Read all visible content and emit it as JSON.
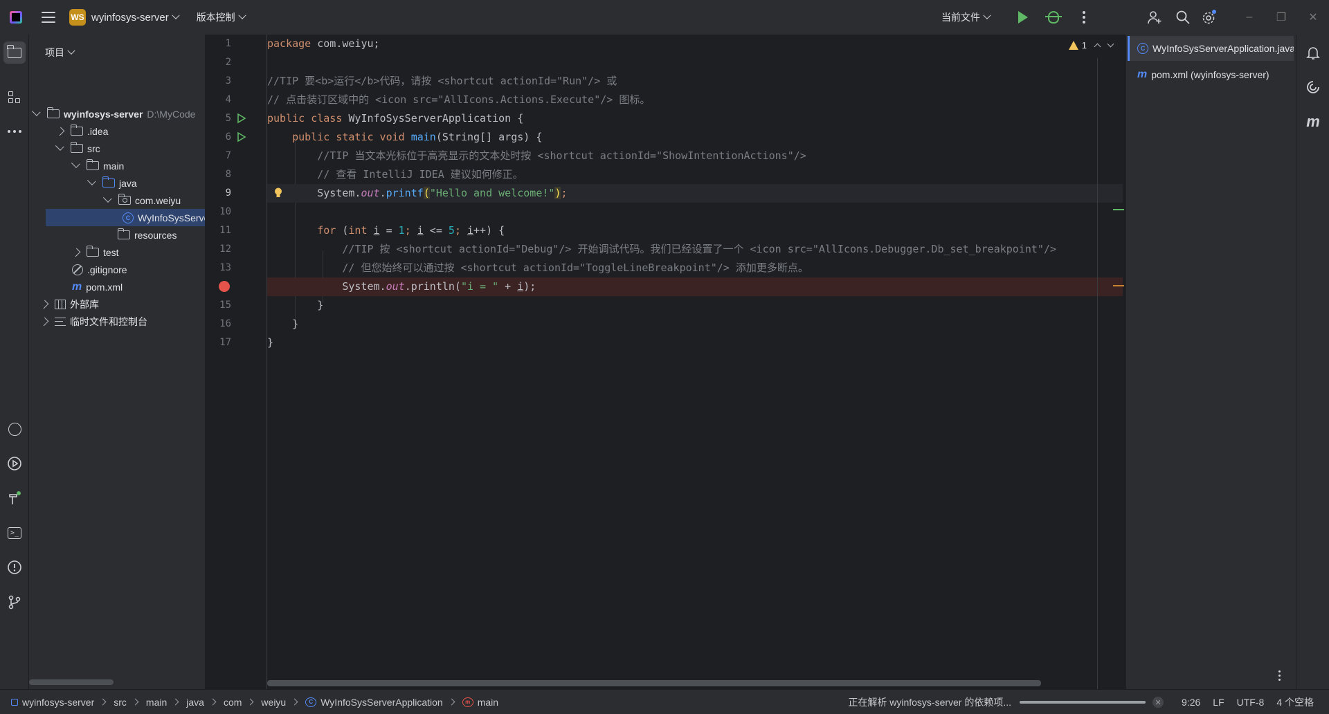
{
  "titlebar": {
    "project_badge": "WS",
    "project_name": "wyinfosys-server",
    "vcs_label": "版本控制",
    "run_config": "当前文件"
  },
  "project_panel": {
    "title": "项目",
    "tree": [
      {
        "label": "wyinfosys-server",
        "extra": "D:\\MyCode",
        "expanded": true
      },
      {
        "label": ".idea",
        "expanded": false
      },
      {
        "label": "src",
        "expanded": true
      },
      {
        "label": "main",
        "expanded": true
      },
      {
        "label": "java",
        "expanded": true
      },
      {
        "label": "com.weiyu",
        "expanded": true
      },
      {
        "label": "WyInfoSysServerApplication",
        "selected": true
      },
      {
        "label": "resources"
      },
      {
        "label": "test",
        "expanded": false
      },
      {
        "label": ".gitignore"
      },
      {
        "label": "pom.xml"
      },
      {
        "label": "外部库",
        "expanded": false
      },
      {
        "label": "临时文件和控制台",
        "expanded": false
      }
    ]
  },
  "editor": {
    "line_numbers": [
      "1",
      "2",
      "3",
      "4",
      "5",
      "6",
      "7",
      "8",
      "9",
      "10",
      "11",
      "12",
      "13",
      "14",
      "15",
      "16",
      "17"
    ],
    "current_line": 9,
    "breakpoint_line": 14,
    "warnings": "1",
    "code": {
      "l1_kw": "package",
      "l1_rest": " com.weiyu;",
      "l3": "//TIP 要<b>运行</b>代码，请按 <shortcut actionId=\"Run\"/> 或",
      "l4": "// 点击装订区域中的 <icon src=\"AllIcons.Actions.Execute\"/> 图标。",
      "l5_kw": "public class",
      "l5_rest": " WyInfoSysServerApplication {",
      "l6_kw": "public static void",
      "l6_fn": "main",
      "l6_rest": "(String[] args) {",
      "l7": "//TIP 当文本光标位于高亮显示的文本处时按 <shortcut actionId=\"ShowIntentionActions\"/>",
      "l8": "// 查看 IntelliJ IDEA 建议如何修正。",
      "l9_a": "System.",
      "l9_out": "out",
      "l9_b": ".",
      "l9_fn": "printf",
      "l9_p1": "(",
      "l9_str": "\"Hello and welcome!\"",
      "l9_p2": ")",
      "l9_semi": ";",
      "l11_kw": "for",
      "l11_a": " (",
      "l11_int": "int",
      "l11_b": " ",
      "l11_i1": "i",
      "l11_c": " = ",
      "l11_n1": "1",
      "l11_d": "; ",
      "l11_i2": "i",
      "l11_e": " <= ",
      "l11_n2": "5",
      "l11_f": "; ",
      "l11_i3": "i",
      "l11_g": "++) {",
      "l12": "//TIP 按 <shortcut actionId=\"Debug\"/> 开始调试代码。我们已经设置了一个 <icon src=\"AllIcons.Debugger.Db_set_breakpoint\"/>",
      "l13": "// 但您始终可以通过按 <shortcut actionId=\"ToggleLineBreakpoint\"/> 添加更多断点。",
      "l14_a": "System.",
      "l14_out": "out",
      "l14_b": ".println(",
      "l14_str": "\"i = \"",
      "l14_c": " + ",
      "l14_i": "i",
      "l14_d": ");",
      "l15": "}",
      "l16": "}",
      "l17": "}"
    }
  },
  "switcher": {
    "items": [
      "WyInfoSysServerApplication.java",
      "pom.xml (wyinfosys-server)"
    ]
  },
  "statusbar": {
    "crumbs": [
      "wyinfosys-server",
      "src",
      "main",
      "java",
      "com",
      "weiyu",
      "WyInfoSysServerApplication",
      "main"
    ],
    "task": "正在解析 wyinfosys-server 的依赖项...",
    "task_progress": 1.0,
    "position": "9:26",
    "line_sep": "LF",
    "encoding": "UTF-8",
    "indent": "4 个空格"
  },
  "colors": {
    "accent": "#548af7",
    "run_green": "#5fb865",
    "breakpoint_red": "#e5534b",
    "warning_yellow": "#f2c55c",
    "badge_gold": "#c48f1a"
  }
}
